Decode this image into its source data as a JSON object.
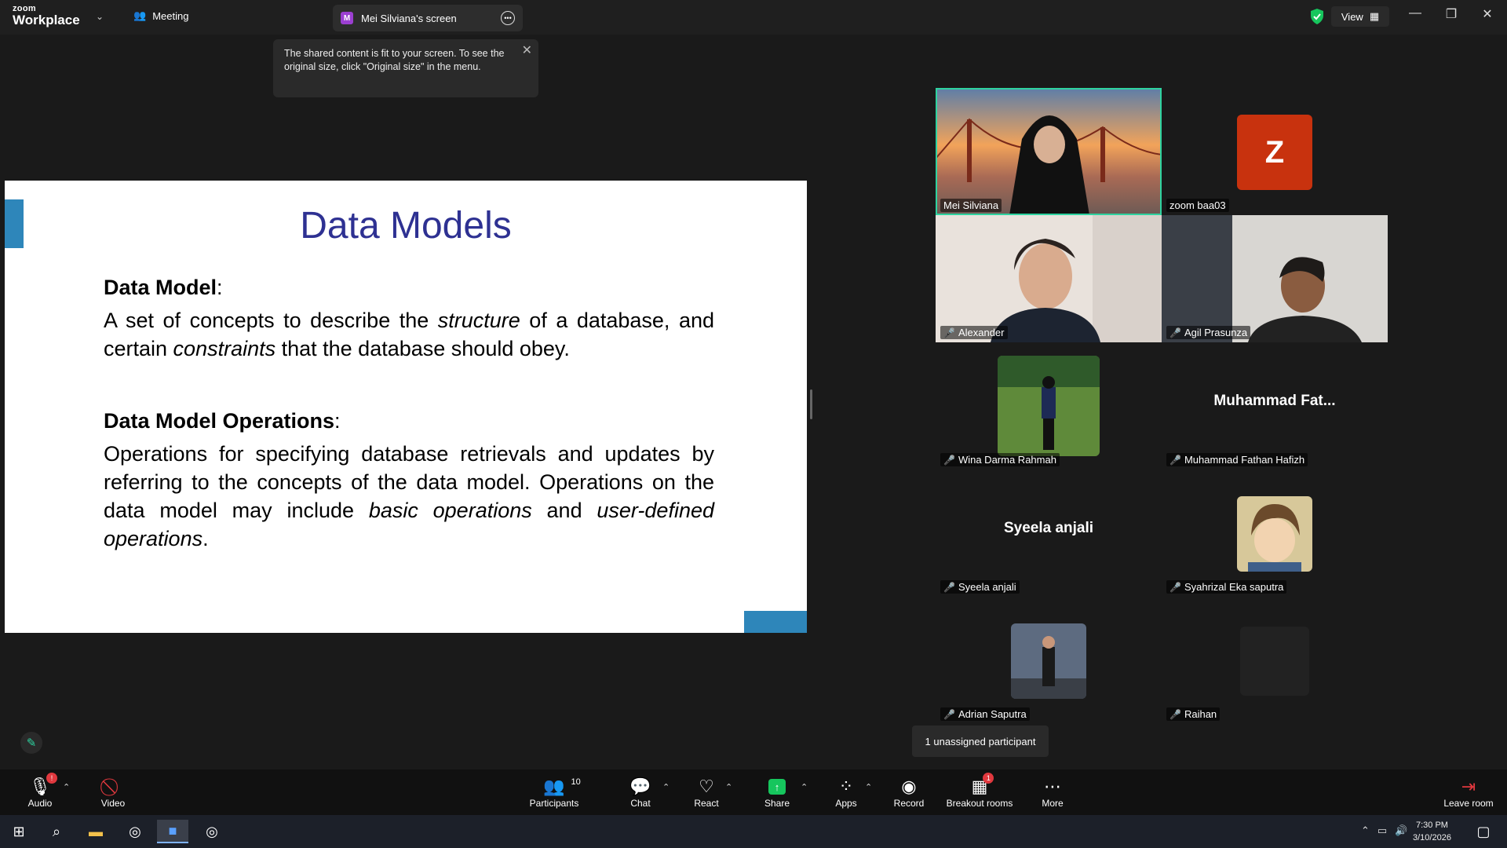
{
  "app": {
    "brand_top": "zoom",
    "brand_bottom": "Workplace",
    "meeting_label": "Meeting"
  },
  "screen_tab": {
    "initial": "M",
    "title": "Mei Silviana's screen"
  },
  "view_label": "View",
  "tooltip": {
    "text": "The shared content is fit to your screen. To see the original size, click \"Original size\" in the menu."
  },
  "slide": {
    "title": "Data Models",
    "section1_head": "Data Model",
    "section1_p1": "A set of concepts to describe the ",
    "section1_em1": "structure",
    "section1_p2": " of a database, and certain ",
    "section1_em2": "constraints",
    "section1_p3": " that the database should obey.",
    "section2_head": "Data Model Operations",
    "section2_p1": "Operations for specifying database retrievals and updates by referring to the concepts of the data model. Operations on the data model may include ",
    "section2_em1": "basic operations",
    "section2_p2": " and ",
    "section2_em2": "user-defined operations",
    "section2_p3": "."
  },
  "participants": [
    {
      "name": "Mei Silviana",
      "muted": false
    },
    {
      "name": "zoom baa03",
      "initial": "Z",
      "muted": false
    },
    {
      "name": "Alexander",
      "muted": true
    },
    {
      "name": "Agil Prasunza",
      "muted": true
    },
    {
      "name": "Wina Darma Rahmah",
      "muted": true
    },
    {
      "name": "Muhammad Fathan Hafizh",
      "display": "Muhammad  Fat...",
      "muted": true
    },
    {
      "name": "Syeela anjali",
      "display": "Syeela anjali",
      "muted": true
    },
    {
      "name": "Syahrizal Eka saputra",
      "muted": true
    },
    {
      "name": "Adrian Saputra",
      "muted": true
    },
    {
      "name": "Raihan",
      "muted": true
    }
  ],
  "unassigned_text": "1 unassigned participant",
  "toolbar": {
    "audio": "Audio",
    "video": "Video",
    "participants": "Participants",
    "participants_count": "10",
    "chat": "Chat",
    "react": "React",
    "share": "Share",
    "apps": "Apps",
    "record": "Record",
    "breakout": "Breakout rooms",
    "breakout_badge": "1",
    "more": "More",
    "leave": "Leave room"
  },
  "taskbar": {
    "time": "7:30 PM",
    "date": "3/10/2026"
  },
  "colors": {
    "accent": "#2ed3a0",
    "slide_title": "#2e3192",
    "slide_bar": "#2e86ba",
    "muted": "#e0383e"
  }
}
